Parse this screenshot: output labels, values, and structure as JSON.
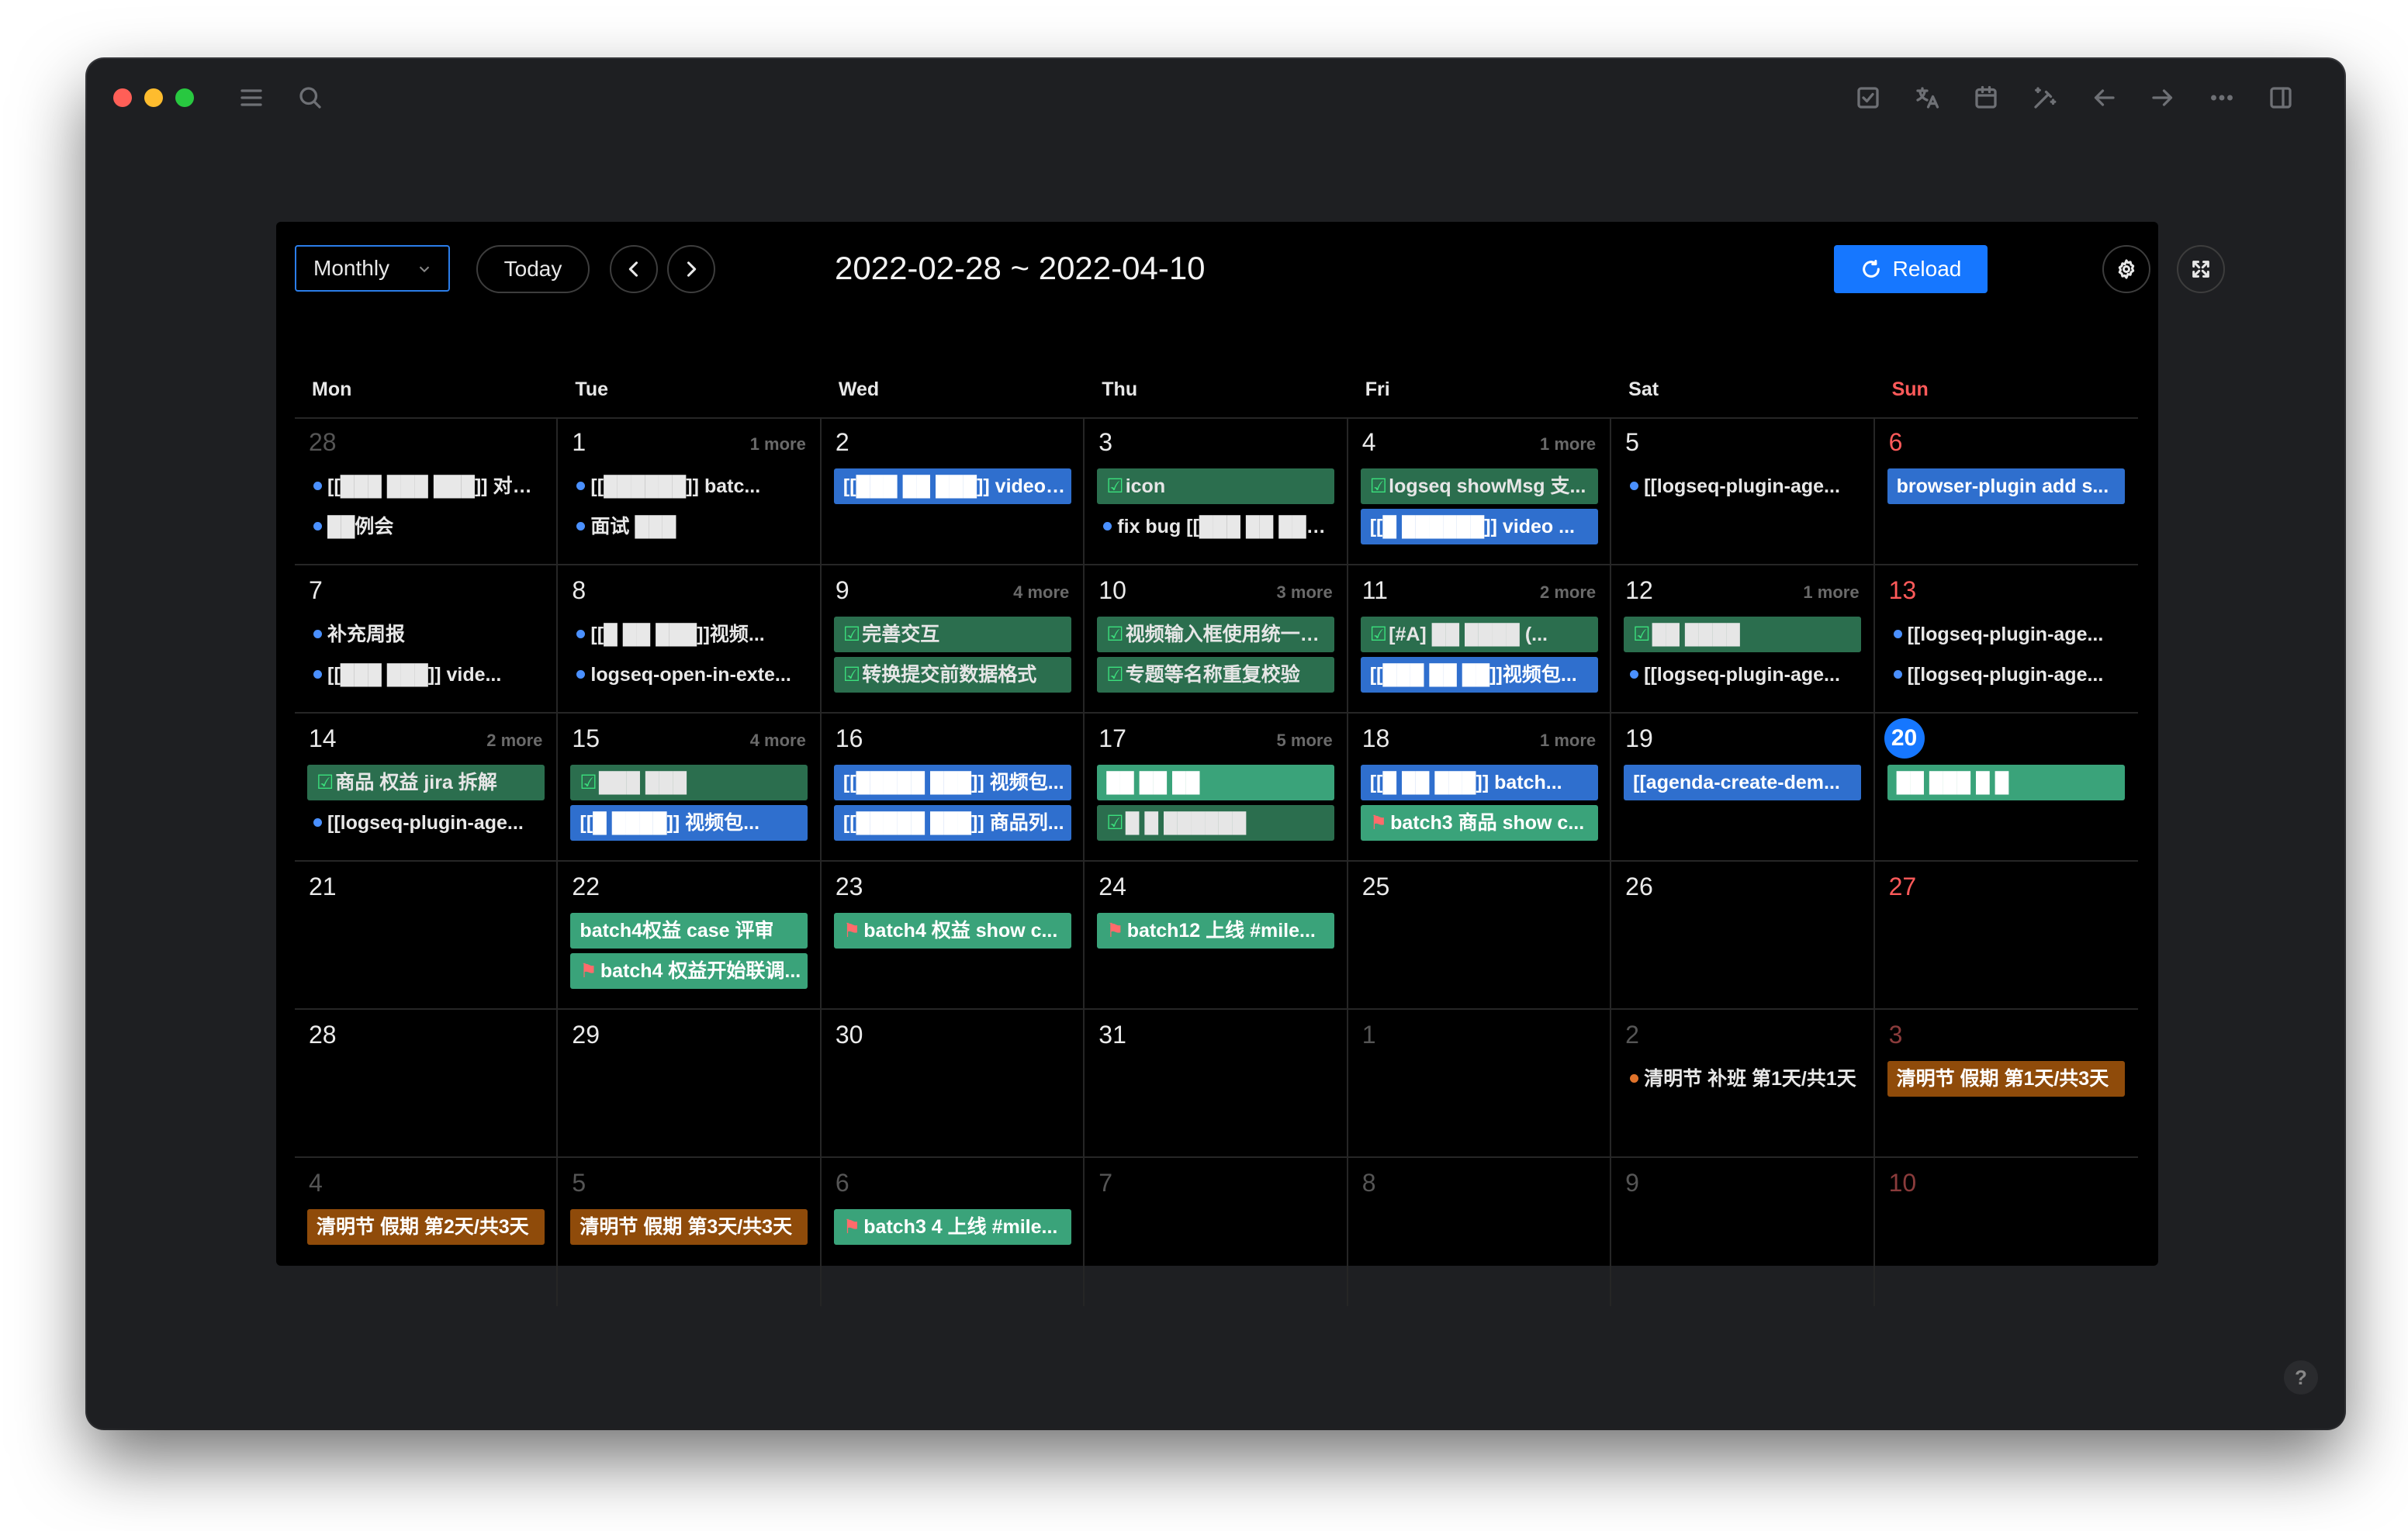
{
  "app": {
    "traffic_colors": [
      "#ff5f57",
      "#febc2e",
      "#28c840"
    ],
    "titlebar_icons": [
      "todo-icon",
      "translate-icon",
      "calendar-icon",
      "wand-icon",
      "arrow-left-icon",
      "arrow-right-icon",
      "more-icon",
      "sidebar-icon"
    ]
  },
  "toolbar": {
    "view": "Monthly",
    "today": "Today",
    "range": "2022-02-28 ~ 2022-04-10",
    "reload": "Reload"
  },
  "weekdays": [
    "Mon",
    "Tue",
    "Wed",
    "Thu",
    "Fri",
    "Sat",
    "Sun"
  ],
  "weeks": [
    [
      {
        "day": "28",
        "dim": true,
        "events": [
          {
            "style": "dot",
            "text": "[[███ ███ ███]] 对接..."
          },
          {
            "style": "dot",
            "text": "██例会"
          }
        ]
      },
      {
        "day": "1",
        "more": "1 more",
        "events": [
          {
            "style": "dot",
            "text": "[[██████]] batc..."
          },
          {
            "style": "dot",
            "text": "面试 ███"
          }
        ]
      },
      {
        "day": "2",
        "events": [
          {
            "style": "blue",
            "text": "[[███ ██ ███]] video ..."
          }
        ]
      },
      {
        "day": "3",
        "events": [
          {
            "style": "green",
            "check": true,
            "text": "icon"
          },
          {
            "style": "dot",
            "text": "fix bug [[███ ██ ███]]"
          }
        ]
      },
      {
        "day": "4",
        "more": "1 more",
        "events": [
          {
            "style": "green",
            "check": true,
            "text": "logseq showMsg 支..."
          },
          {
            "style": "blue",
            "text": "[[█ ██████]] video ..."
          }
        ]
      },
      {
        "day": "5",
        "events": [
          {
            "style": "dot",
            "text": "[[logseq-plugin-age..."
          }
        ]
      },
      {
        "day": "6",
        "sun": true,
        "events": [
          {
            "style": "blue",
            "text": "browser-plugin add s..."
          }
        ]
      }
    ],
    [
      {
        "day": "7",
        "events": [
          {
            "style": "dot",
            "text": "补充周报"
          },
          {
            "style": "dot",
            "text": "[[███ ███]] vide..."
          }
        ]
      },
      {
        "day": "8",
        "events": [
          {
            "style": "dot",
            "text": "[[█ ██ ███]]视频..."
          },
          {
            "style": "dot",
            "text": "logseq-open-in-exte..."
          }
        ]
      },
      {
        "day": "9",
        "more": "4 more",
        "events": [
          {
            "style": "green",
            "check": true,
            "text": "完善交互"
          },
          {
            "style": "green",
            "check": true,
            "text": "转换提交前数据格式"
          }
        ]
      },
      {
        "day": "10",
        "more": "3 more",
        "events": [
          {
            "style": "green",
            "check": true,
            "text": "视频输入框使用统一的..."
          },
          {
            "style": "green",
            "check": true,
            "text": "专题等名称重复校验"
          }
        ]
      },
      {
        "day": "11",
        "more": "2 more",
        "events": [
          {
            "style": "green",
            "check": true,
            "text": "[#A] ██ ████ (..."
          },
          {
            "style": "blue",
            "text": "[[███ ██ ██]]视频包..."
          }
        ]
      },
      {
        "day": "12",
        "more": "1 more",
        "events": [
          {
            "style": "green",
            "check": true,
            "text": "██ ████"
          },
          {
            "style": "dot",
            "text": "[[logseq-plugin-age..."
          }
        ]
      },
      {
        "day": "13",
        "sun": true,
        "events": [
          {
            "style": "dot",
            "text": "[[logseq-plugin-age..."
          },
          {
            "style": "dot",
            "text": "[[logseq-plugin-age..."
          }
        ]
      }
    ],
    [
      {
        "day": "14",
        "more": "2 more",
        "events": [
          {
            "style": "green",
            "check": true,
            "text": "商品 权益 jira 拆解"
          },
          {
            "style": "dot",
            "text": "[[logseq-plugin-age..."
          }
        ]
      },
      {
        "day": "15",
        "more": "4 more",
        "events": [
          {
            "style": "green",
            "check": true,
            "text": "███ ███"
          },
          {
            "style": "blue",
            "text": "[[█ ████]] 视频包..."
          }
        ]
      },
      {
        "day": "16",
        "events": [
          {
            "style": "blue",
            "text": "[[█████ ███]] 视频包..."
          },
          {
            "style": "blue",
            "text": "[[█████ ███]] 商品列..."
          }
        ]
      },
      {
        "day": "17",
        "more": "5 more",
        "events": [
          {
            "style": "lightgreen",
            "text": "██ ██ ██"
          },
          {
            "style": "green",
            "check": true,
            "text": "█ █ ██████"
          }
        ]
      },
      {
        "day": "18",
        "more": "1 more",
        "events": [
          {
            "style": "blue",
            "text": "[[█ ██ ███]] batch..."
          },
          {
            "style": "lightgreen",
            "flag": true,
            "text": "batch3 商品 show c..."
          }
        ]
      },
      {
        "day": "19",
        "events": [
          {
            "style": "blue",
            "text": "[[agenda-create-dem..."
          }
        ]
      },
      {
        "day": "20",
        "sun": true,
        "today": true,
        "events": [
          {
            "style": "lightgreen",
            "text": "██ ███ █ █"
          }
        ]
      }
    ],
    [
      {
        "day": "21",
        "events": []
      },
      {
        "day": "22",
        "events": [
          {
            "style": "lightgreen",
            "text": "batch4权益 case 评审"
          },
          {
            "style": "lightgreen",
            "flag": true,
            "text": "batch4 权益开始联调..."
          }
        ]
      },
      {
        "day": "23",
        "events": [
          {
            "style": "lightgreen",
            "flag": true,
            "text": "batch4 权益 show c..."
          }
        ]
      },
      {
        "day": "24",
        "events": [
          {
            "style": "lightgreen",
            "flag": true,
            "text": "batch12 上线 #mile..."
          }
        ]
      },
      {
        "day": "25",
        "events": []
      },
      {
        "day": "26",
        "events": []
      },
      {
        "day": "27",
        "sun": true,
        "events": []
      }
    ],
    [
      {
        "day": "28",
        "events": []
      },
      {
        "day": "29",
        "events": []
      },
      {
        "day": "30",
        "events": []
      },
      {
        "day": "31",
        "events": []
      },
      {
        "day": "1",
        "dim": true,
        "events": []
      },
      {
        "day": "2",
        "dim": true,
        "events": [
          {
            "style": "dot-orange",
            "text": "清明节 补班 第1天/共1天"
          }
        ]
      },
      {
        "day": "3",
        "sun": true,
        "dim": true,
        "events": [
          {
            "style": "orange",
            "text": "清明节 假期 第1天/共3天"
          }
        ]
      }
    ],
    [
      {
        "day": "4",
        "dim": true,
        "events": [
          {
            "style": "orange",
            "text": "清明节 假期 第2天/共3天"
          }
        ]
      },
      {
        "day": "5",
        "dim": true,
        "events": [
          {
            "style": "orange",
            "text": "清明节 假期 第3天/共3天"
          }
        ]
      },
      {
        "day": "6",
        "dim": true,
        "events": [
          {
            "style": "lightgreen",
            "flag": true,
            "text": "batch3 4 上线 #mile..."
          }
        ]
      },
      {
        "day": "7",
        "dim": true,
        "events": []
      },
      {
        "day": "8",
        "dim": true,
        "events": []
      },
      {
        "day": "9",
        "dim": true,
        "events": []
      },
      {
        "day": "10",
        "sun": true,
        "dim": true,
        "events": []
      }
    ]
  ],
  "help": "?"
}
